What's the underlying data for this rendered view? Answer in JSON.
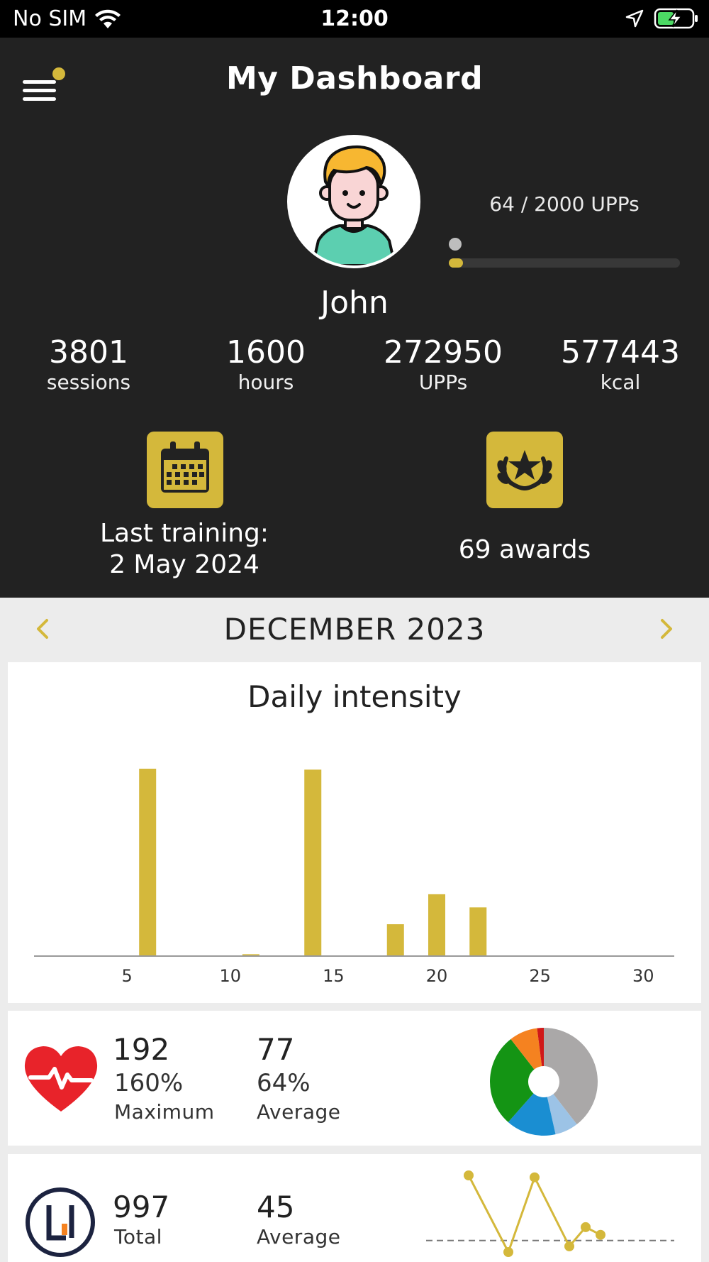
{
  "status_bar": {
    "carrier": "No SIM",
    "time": "12:00"
  },
  "header": {
    "title": "My Dashboard"
  },
  "profile": {
    "name": "John",
    "upp_progress_text": "64 / 2000 UPPs",
    "upp_current": 64,
    "upp_goal": 2000
  },
  "stats": [
    {
      "value": "3801",
      "unit": "sessions"
    },
    {
      "value": "1600",
      "unit": "hours"
    },
    {
      "value": "272950",
      "unit": "UPPs"
    },
    {
      "value": "577443",
      "unit": "kcal"
    }
  ],
  "tiles": {
    "last_training_line1": "Last training:",
    "last_training_line2": "2 May 2024",
    "awards": "69 awards"
  },
  "month_nav": {
    "label": "DECEMBER 2023",
    "prev_icon": "chevron-left-icon",
    "next_icon": "chevron-right-icon"
  },
  "colors": {
    "accent": "#d4b83b",
    "dark_bg": "#222222",
    "heart": "#e8232a"
  },
  "chart_data": {
    "type": "bar",
    "title": "Daily intensity",
    "x": [
      6,
      11,
      14,
      18,
      20,
      22
    ],
    "values": [
      100,
      1,
      99.5,
      17,
      33,
      26
    ],
    "xticks": [
      5,
      10,
      15,
      20,
      25,
      30
    ],
    "xlim": [
      0.5,
      31.5
    ],
    "ylim": [
      0,
      100
    ],
    "xlabel": "",
    "ylabel": "",
    "grid": false
  },
  "heart_rate": {
    "max_value": "192",
    "max_pct": "160%",
    "max_label": "Maximum",
    "avg_value": "77",
    "avg_pct": "64%",
    "avg_label": "Average",
    "zones": [
      {
        "color": "#aaa8a8",
        "share": 0.395
      },
      {
        "color": "#9cc3e6",
        "share": 0.07
      },
      {
        "color": "#1a8ed2",
        "share": 0.15
      },
      {
        "color": "#149414",
        "share": 0.28
      },
      {
        "color": "#f58220",
        "share": 0.085
      },
      {
        "color": "#d01818",
        "share": 0.02
      }
    ]
  },
  "upps_card": {
    "total_value": "997",
    "total_label": "Total",
    "avg_value": "45",
    "avg_label": "Average",
    "trend_values": [
      80,
      0,
      78,
      6,
      26,
      18
    ],
    "average_line": 12
  }
}
